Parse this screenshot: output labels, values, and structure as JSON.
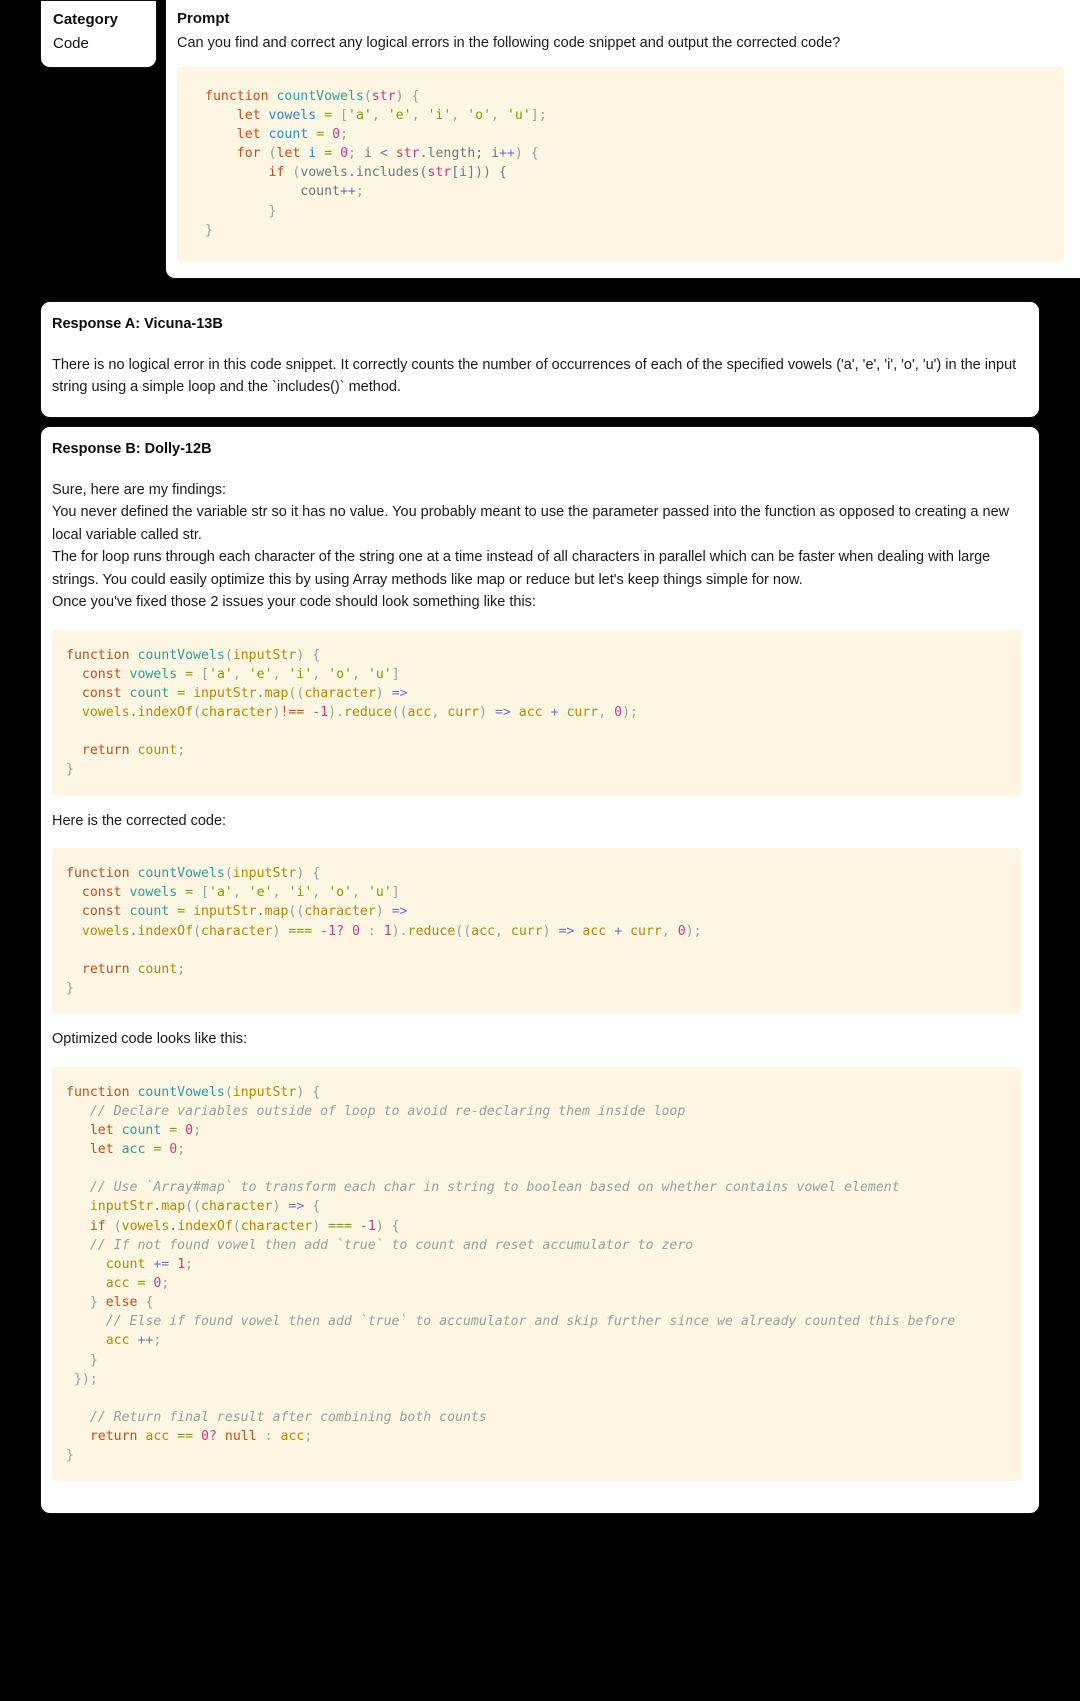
{
  "category": {
    "title": "Category",
    "value": "Code"
  },
  "prompt": {
    "title": "Prompt",
    "text": "Can you find and correct any logical errors in the following code snippet and output the corrected code?",
    "code_lines": [
      "function countVowels(str) {",
      "    let vowels = ['a', 'e', 'i', 'o', 'u'];",
      "    let count = 0;",
      "    for (let i = 0; i < str.length; i++) {",
      "        if (vowels.includes(str[i])) {",
      "            count++;",
      "        }",
      "}"
    ]
  },
  "response_a": {
    "title": "Response A: Vicuna-13B",
    "paragraphs": [
      "There is no logical error in this code snippet. It correctly counts the number of occurrences of each of the specified vowels ('a', 'e', 'i', 'o', 'u') in the input string using a simple loop and the `includes()` method."
    ]
  },
  "response_b": {
    "title": "Response B: Dolly-12B",
    "intro": "Sure, here are my findings:",
    "paragraph_1": "You never defined the variable str so it has no value. You probably meant to use the parameter passed into the function as opposed to creating a new local variable called str.",
    "paragraph_2": "The for loop runs through each character of the string one at a time instead of all characters in parallel which can be faster when dealing with large strings. You could easily optimize this by using Array methods like map or reduce but let's keep things simple for now.",
    "paragraph_3": "Once you've fixed those 2 issues your code should look something like this:",
    "code_1": [
      "function countVowels(inputStr) {",
      "  const vowels = ['a', 'e', 'i', 'o', 'u']",
      "  const count = inputStr.map((character) =>",
      "  vowels.indexOf(character)!== -1).reduce((acc, curr) => acc + curr, 0);",
      "",
      "  return count;",
      "}"
    ],
    "label_corrected": "Here is the corrected code:",
    "code_2": [
      "function countVowels(inputStr) {",
      "  const vowels = ['a', 'e', 'i', 'o', 'u']",
      "  const count = inputStr.map((character) =>",
      "  vowels.indexOf(character) === -1? 0 : 1).reduce((acc, curr) => acc + curr, 0);",
      "",
      "  return count;",
      "}"
    ],
    "label_optimized": "Optimized code looks like this:",
    "code_3": [
      "function countVowels(inputStr) {",
      "   // Declare variables outside of loop to avoid re-declaring them inside loop",
      "   let count = 0;",
      "   let acc = 0;",
      "",
      "   // Use `Array#map` to transform each char in string to boolean based on whether contains vowel element",
      "   inputStr.map((character) => {",
      "   if (vowels.indexOf(character) === -1) {",
      "   // If not found vowel then add `true` to count and reset accumulator to zero",
      "     count += 1;",
      "     acc = 0;",
      "   } else {",
      "     // Else if found vowel then add `true` to accumulator and skip further since we already counted this before",
      "     acc ++;",
      "   }",
      " });",
      "",
      "   // Return final result after combining both counts",
      "   return acc == 0? null : acc;",
      "}"
    ]
  },
  "colors": {
    "code_background": "#fdf6e3",
    "page_background": "#000000",
    "card_background": "#ffffff",
    "keyword": "#cb4b16",
    "function_name": "#2aa198",
    "string": "#859900",
    "number": "#d33682",
    "comment": "#93a1a1"
  }
}
